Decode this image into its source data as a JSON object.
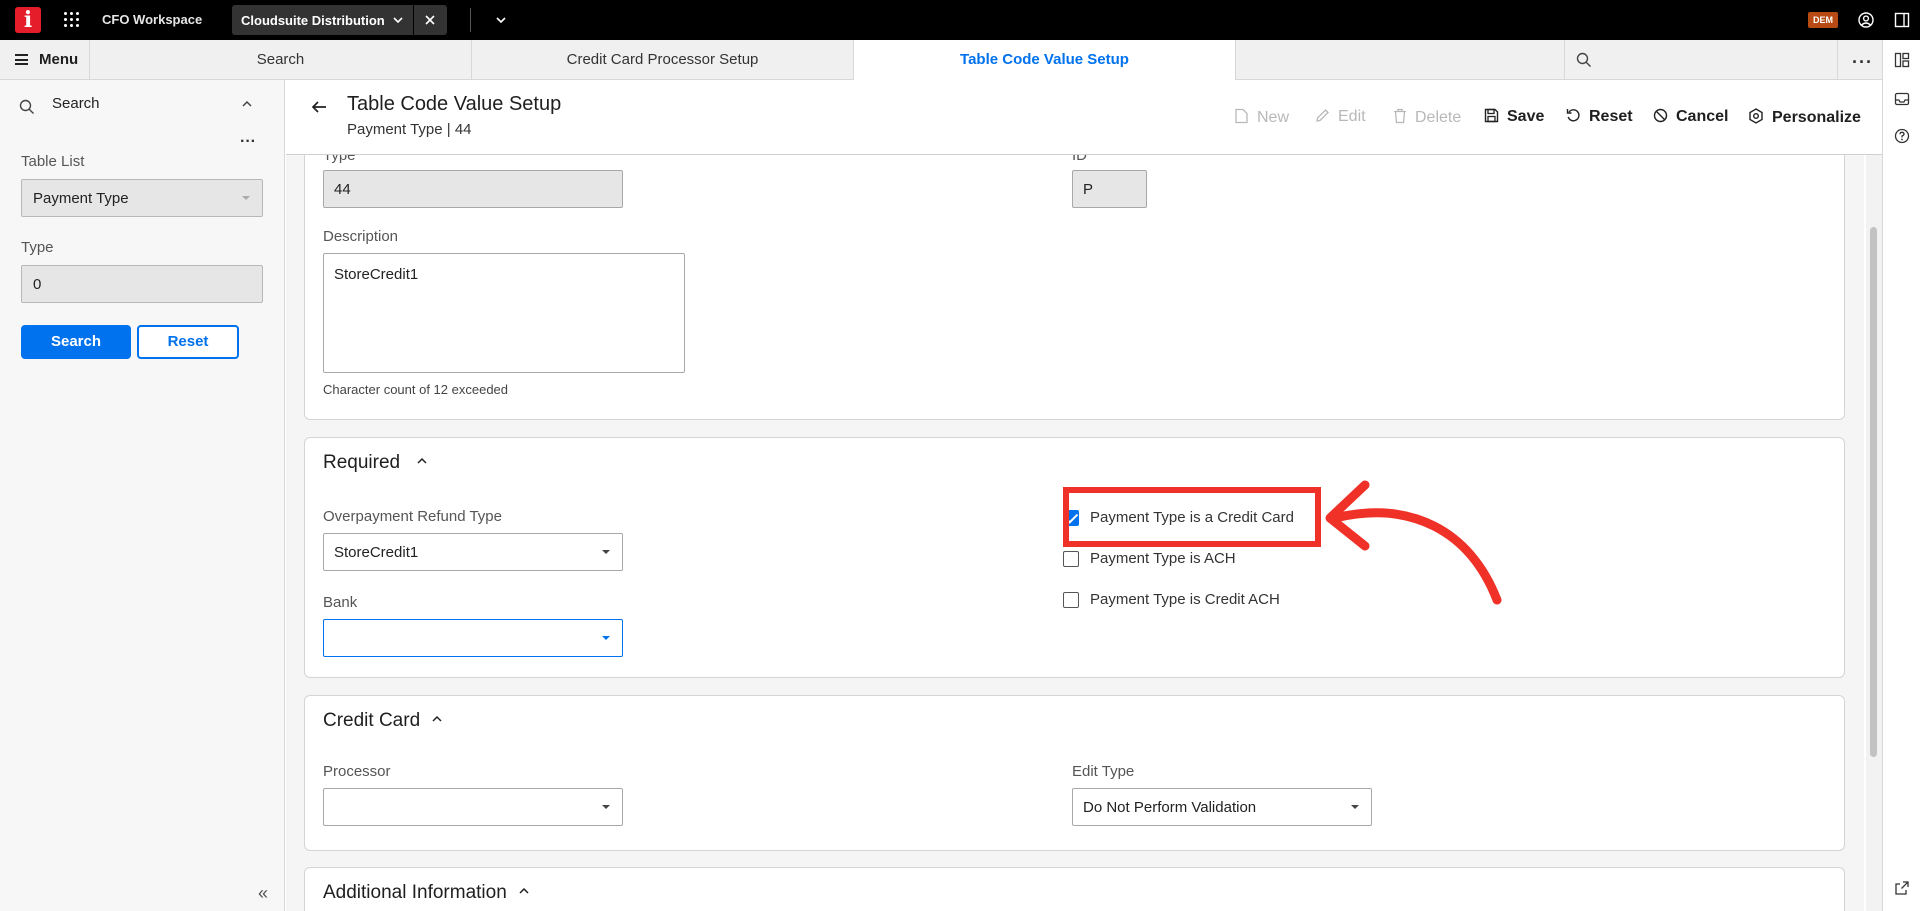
{
  "topbar": {
    "workspace_title": "CFO Workspace",
    "app_tab_label": "Cloudsuite Distribution",
    "badge": "DEM"
  },
  "tabs": {
    "menu_label": "Menu",
    "items": [
      {
        "label": "Search"
      },
      {
        "label": "Credit Card Processor Setup"
      },
      {
        "label": "Table Code Value Setup"
      }
    ],
    "search_placeholder": ""
  },
  "left_panel": {
    "search_label": "Search",
    "table_list_label": "Table List",
    "table_list_value": "Payment Type",
    "type_label": "Type",
    "type_value": "0",
    "search_button": "Search",
    "reset_button": "Reset"
  },
  "header": {
    "title": "Table Code Value Setup",
    "subtitle": "Payment Type | 44",
    "toolbar": {
      "new": "New",
      "edit": "Edit",
      "delete": "Delete",
      "save": "Save",
      "reset": "Reset",
      "cancel": "Cancel",
      "personalize": "Personalize"
    }
  },
  "general": {
    "type_label": "Type",
    "type_value": "44",
    "id_label": "ID",
    "id_value": "P",
    "description_label": "Description",
    "description_value": "StoreCredit1",
    "description_hint": "Character count of 12 exceeded"
  },
  "required": {
    "title": "Required",
    "overpayment_label": "Overpayment Refund Type",
    "overpayment_value": "StoreCredit1",
    "bank_label": "Bank",
    "bank_value": "",
    "checkboxes": [
      {
        "label": "Payment Type is a Credit Card",
        "checked": true
      },
      {
        "label": "Payment Type is ACH",
        "checked": false
      },
      {
        "label": "Payment Type is Credit ACH",
        "checked": false
      }
    ]
  },
  "credit_card": {
    "title": "Credit Card",
    "processor_label": "Processor",
    "processor_value": "",
    "edit_type_label": "Edit Type",
    "edit_type_value": "Do Not Perform Validation"
  },
  "additional": {
    "title": "Additional Information"
  },
  "colors": {
    "accent": "#0072ed",
    "annotation": "#f03128",
    "logo": "#e51d2a",
    "badge": "#b74b13"
  }
}
